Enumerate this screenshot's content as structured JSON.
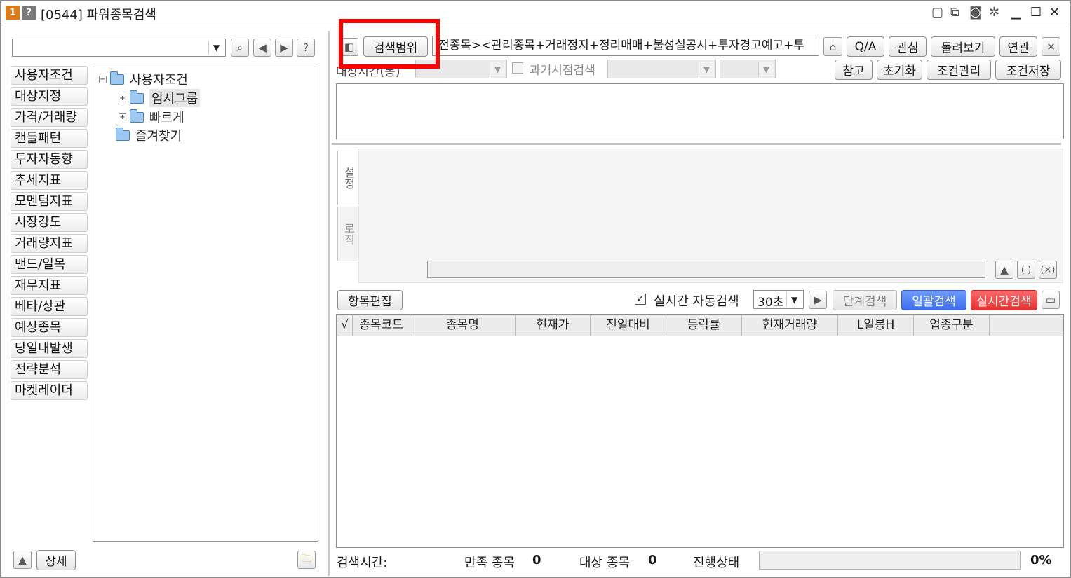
{
  "titlebar": {
    "badge_num": "1",
    "badge_help": "?",
    "title": "[0544] 파워종목검색"
  },
  "left": {
    "categories": [
      "사용자조건",
      "대상지정",
      "가격/거래량",
      "캔들패턴",
      "투자자동향",
      "추세지표",
      "모멘텀지표",
      "시장강도",
      "거래량지표",
      "밴드/일목",
      "재무지표",
      "베타/상관",
      "예상종목",
      "당일내발생",
      "전략분석",
      "마켓레이더"
    ],
    "tree": {
      "root": "사용자조건",
      "child1": "임시그룹",
      "child2": "빠르게",
      "favorites": "즐겨찾기"
    },
    "detail_button": "상세"
  },
  "toolbar": {
    "search_range_button": "검색범위",
    "condition_text": "전종목><관리종목+거래정지+정리매매+불성실공시+투자경고예고+투",
    "qa_button": "Q/A",
    "interest_button": "관심",
    "rotate_view_button": "돌려보기",
    "related_button": "연관",
    "target_time_label": "대상시간(봉)",
    "past_search_label": "과거시점검색",
    "ref_button": "참고",
    "reset_button": "초기화",
    "condition_manage_button": "조건관리",
    "condition_save_button": "조건저장"
  },
  "side_tabs": {
    "setting": "설정",
    "logic": "로직"
  },
  "logic_buttons": {
    "paren": "( )",
    "x": "(×)"
  },
  "search_bar": {
    "item_edit_button": "항목편집",
    "realtime_auto_label": "실시간 자동검색",
    "interval_value": "30초",
    "step_search_button": "단계검색",
    "batch_search_button": "일괄검색",
    "realtime_search_button": "실시간검색"
  },
  "grid": {
    "columns": [
      "√",
      "종목코드",
      "종목명",
      "현재가",
      "전일대비",
      "등락률",
      "현재거래량",
      "L일봉H",
      "업종구분"
    ]
  },
  "status": {
    "search_time_label": "검색시간:",
    "matched_label": "만족 종목",
    "matched_value": "0",
    "target_label": "대상 종목",
    "target_value": "0",
    "progress_label": "진행상태",
    "progress_value": "0%"
  },
  "colors": {
    "highlight": "#ff0000",
    "batch_blue": "#3d6df0",
    "realtime_red": "#e83030"
  }
}
